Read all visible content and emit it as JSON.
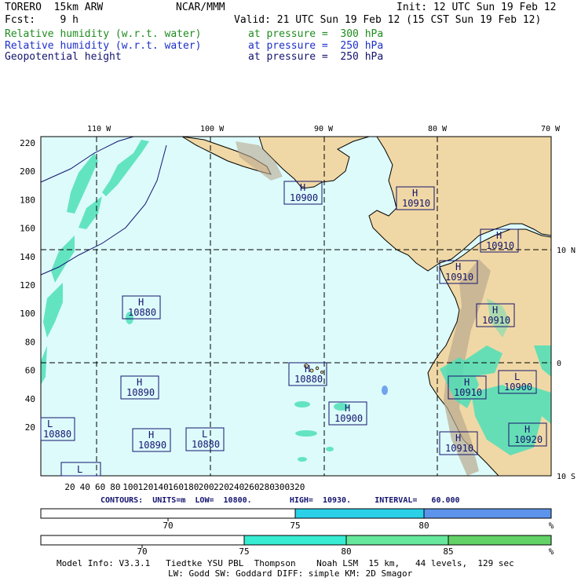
{
  "header": {
    "model": "TORERO  15km ARW",
    "org": "NCAR/MMM",
    "init": "Init: 12 UTC Sun 19 Feb 12",
    "fcst": "Fcst:    9 h",
    "valid": "Valid: 21 UTC Sun 19 Feb 12 (15 CST Sun 19 Feb 12)",
    "fields": [
      {
        "name": "Relative humidity (w.r.t. water)",
        "level": "at pressure =  300 hPa",
        "color": "#1f8c1f"
      },
      {
        "name": "Relative humidity (w.r.t. water)",
        "level": "at pressure =  250 hPa",
        "color": "#1d2fc9"
      },
      {
        "name": "Geopotential height",
        "level": "at pressure =  250 hPa",
        "color": "#14146e"
      }
    ]
  },
  "map": {
    "top_lon_labels": [
      "110 W",
      "100 W",
      "90 W",
      "80 W",
      "70 W"
    ],
    "right_lat_labels": [
      "10 N",
      "0",
      "10 S"
    ],
    "y_ticks": [
      "220",
      "200",
      "180",
      "160",
      "140",
      "120",
      "100",
      "80",
      "60",
      "40",
      "20"
    ],
    "x_ticks": [
      "20",
      "40",
      "60",
      "80",
      "100",
      "120",
      "140",
      "160",
      "180",
      "200",
      "220",
      "240",
      "260",
      "280",
      "300",
      "320"
    ],
    "ocean_color": "#ddfbfb",
    "land_color": "#f0d8a6",
    "highs": [
      {
        "letter": "H",
        "value": "10900"
      },
      {
        "letter": "H",
        "value": "10910"
      },
      {
        "letter": "H",
        "value": "10910"
      },
      {
        "letter": "H",
        "value": "10910"
      },
      {
        "letter": "H",
        "value": "10880"
      },
      {
        "letter": "H",
        "value": "10910"
      },
      {
        "letter": "H",
        "value": "10880"
      },
      {
        "letter": "H",
        "value": "10890"
      },
      {
        "letter": "H",
        "value": "10910"
      },
      {
        "letter": "L",
        "value": "10900"
      },
      {
        "letter": "H",
        "value": "10900"
      },
      {
        "letter": "L",
        "value": "10880"
      },
      {
        "letter": "H",
        "value": "10890"
      },
      {
        "letter": "L",
        "value": "10880"
      },
      {
        "letter": "H",
        "value": "10910"
      },
      {
        "letter": "H",
        "value": "10920"
      },
      {
        "letter": "L",
        "value": ""
      }
    ]
  },
  "contours": "CONTOURS:  UNITS=m  LOW=  10800.        HIGH=  10930.     INTERVAL=   60.000",
  "colorbar_250": {
    "colors": [
      "#ffffff",
      "#2ad0e8",
      "#5c94ec"
    ],
    "labels": [
      "70",
      "75",
      "80"
    ],
    "unit": "%"
  },
  "colorbar_300": {
    "colors": [
      "#ffffff",
      "#36ecd2",
      "#66e89c",
      "#62d266"
    ],
    "labels": [
      "70",
      "75",
      "80",
      "85"
    ],
    "unit": "%"
  },
  "footer": {
    "line1": "Model Info: V3.3.1   Tiedtke YSU PBL  Thompson    Noah LSM  15 km,   44 levels,  129 sec",
    "line2": "LW: Godd SW: Goddard DIFF: simple KM: 2D Smagor"
  }
}
